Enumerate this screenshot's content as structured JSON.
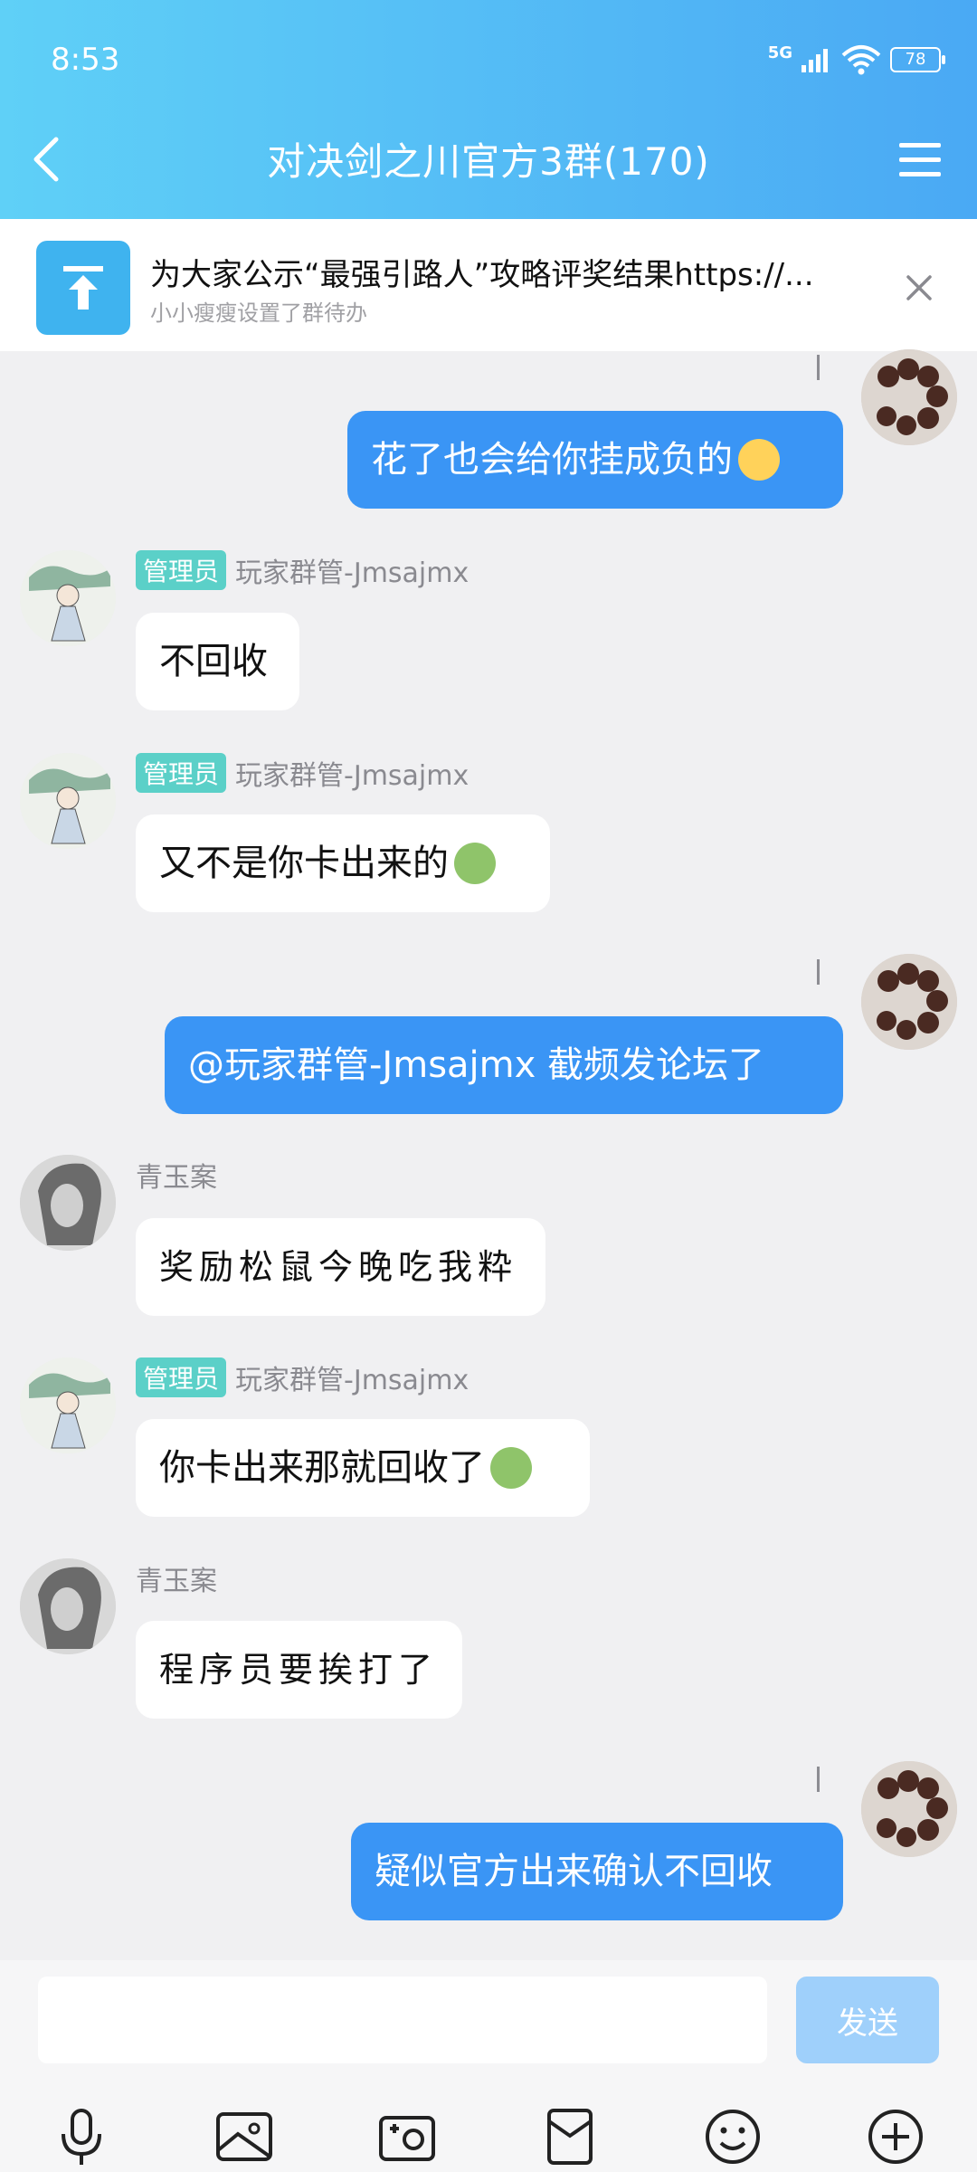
{
  "status": {
    "time": "8:53",
    "network": "5G",
    "battery": "78"
  },
  "header": {
    "title": "对决剑之川官方3群(170)"
  },
  "pinned": {
    "title": "为大家公示“最强引路人”攻略评奖结果https://...",
    "subtitle": "小小瘦瘦设置了群待办"
  },
  "messages": [
    {
      "side": "me",
      "text": "花了也会给你挂成负的"
    },
    {
      "side": "other",
      "badge": "管理员",
      "sender": "玩家群管-Jmsajmx",
      "text": "不回收"
    },
    {
      "side": "other",
      "badge": "管理员",
      "sender": "玩家群管-Jmsajmx",
      "text": "又不是你卡出来的"
    },
    {
      "side": "me",
      "text": "@玩家群管-Jmsajmx 截频发论坛了"
    },
    {
      "side": "other",
      "sender": "青玉案",
      "text": "奖励松鼠今晚吃我粋"
    },
    {
      "side": "other",
      "badge": "管理员",
      "sender": "玩家群管-Jmsajmx",
      "text": "你卡出来那就回收了"
    },
    {
      "side": "other",
      "sender": "青玉案",
      "text": "程序员要挨打了"
    },
    {
      "side": "me",
      "text": "疑似官方出来确认不回收"
    }
  ],
  "input": {
    "placeholder": "",
    "send_label": "发送"
  },
  "toolbar": [
    "mic-icon",
    "image-icon",
    "camera-icon",
    "red-packet-icon",
    "emoji-icon",
    "plus-icon"
  ],
  "colors": {
    "header_start": "#5fd0f7",
    "header_end": "#4aa9f4",
    "bubble_me": "#3a95f5",
    "admin_badge": "#5bd0c8",
    "send_disabled": "#9fd0fb"
  }
}
